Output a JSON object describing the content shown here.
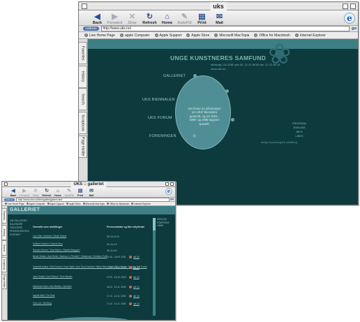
{
  "window_main": {
    "title": "uks",
    "toolbar": [
      {
        "label": "Back",
        "icon": "back-arrow-icon",
        "glyph": "◀",
        "enabled": true
      },
      {
        "label": "Forward",
        "icon": "forward-arrow-icon",
        "glyph": "▶",
        "enabled": false
      },
      {
        "label": "Stop",
        "icon": "stop-icon",
        "glyph": "✕",
        "enabled": false
      },
      {
        "label": "Refresh",
        "icon": "refresh-icon",
        "glyph": "↻",
        "enabled": true
      },
      {
        "label": "Home",
        "icon": "home-icon",
        "glyph": "⌂",
        "enabled": true
      },
      {
        "label": "AutoFill",
        "icon": "autofill-icon",
        "glyph": "✎",
        "enabled": false
      },
      {
        "label": "Print",
        "icon": "print-icon",
        "glyph": "▤",
        "enabled": true
      },
      {
        "label": "Mail",
        "icon": "mail-icon",
        "glyph": "✉",
        "enabled": true
      }
    ],
    "address_label": "Address",
    "address": "http://www.uks.no/",
    "go_label": "go",
    "favorites": [
      "Live Home Page",
      "apple Computer",
      "Apple Support",
      "Apple Store",
      "Microsoft MacTopia",
      "Office for Macintosh",
      "Internet Explorer"
    ],
    "sidebar_tabs": [
      "Favorites",
      "History",
      "Search",
      "Scrapbook",
      "Page Holder"
    ],
    "site": {
      "heading": "UNGE KUNSTNERES SAMFUND",
      "contact_line1": "rådhusgt. 15 0158 oslo 00, 22 42 96 66 fax: 22 42 66 16",
      "contact_line2": "www.uks.no",
      "menu": [
        "GALLERIET",
        "UKS BIENNALEN",
        "UKS FORUM",
        "FORENINGEN"
      ],
      "oval_text": "Her finner du informasjon om UKS' Biennalen generelt, og om 2001-, 1999- og 1998-utgaven spesielt.",
      "right_links": [
        "PROGRAM",
        "ENGLISH",
        "INFO",
        "LINKS"
      ],
      "credit": "design by primarypink publishing"
    }
  },
  "window_gallery": {
    "title": "UKS :: galleriet",
    "toolbar": [
      {
        "label": "Back",
        "icon": "back-arrow-icon",
        "glyph": "◀",
        "enabled": true
      },
      {
        "label": "Forward",
        "icon": "forward-arrow-icon",
        "glyph": "▶",
        "enabled": false
      },
      {
        "label": "Stop",
        "icon": "stop-icon",
        "glyph": "✕",
        "enabled": false
      },
      {
        "label": "Refresh",
        "icon": "refresh-icon",
        "glyph": "↻",
        "enabled": true
      },
      {
        "label": "Home",
        "icon": "home-icon",
        "glyph": "⌂",
        "enabled": true
      },
      {
        "label": "AutoFill",
        "icon": "autofill-icon",
        "glyph": "✎",
        "enabled": false
      },
      {
        "label": "Print",
        "icon": "print-icon",
        "glyph": "▤",
        "enabled": true
      },
      {
        "label": "Mail",
        "icon": "mail-icon",
        "glyph": "✉",
        "enabled": true
      }
    ],
    "address_label": "Address",
    "address": "http://www.uks.no/html/galleri/galleri.html",
    "go_label": "go",
    "favorites": [
      "Live Home Page",
      "Apple Computer",
      "Apple Support",
      "Apple Store",
      "Microsoft MacTopia",
      "Office for Macintosh",
      "Internet Explorer"
    ],
    "sidebar_tabs": [
      "Favorites",
      "History",
      "Search",
      "Scrapbook",
      "Page Holder"
    ],
    "site": {
      "heading": "GALLERIET",
      "left_menu": [
        "OM GALLERIET",
        "KALENDER",
        "TIDLIGERE",
        "PRESSE/KRITIKK",
        "KONTAKT"
      ],
      "col_heading_left": "Oversikt over utstillinger",
      "col_heading_right": "Presseomtale og Mer utfyllende",
      "rows": [
        {
          "title": "Line Ellen Hartvedt / Randi Strand",
          "date": "28. 03-01.04",
          "link": ""
        },
        {
          "title": "Kristine Hansen / Gunnar Moe",
          "date": "24. 04-1.5",
          "link": ""
        },
        {
          "title": "Rannei Grenne / Tone Myhre / Sophie Berggren",
          "date": "28. 5-24.6",
          "link": ""
        },
        {
          "title": "Bente Stokke / Ann Ekroll / Markus Li / Pernille T. Buskerud / Christian Tveit",
          "date": "21.08 - 16.09. 2001",
          "link": "sjå (3)"
        },
        {
          "title": "Svanhild Aasbø / Rolf Groven / Knut Fjelle / Ane Thon Knutsen / Mikal Telle / Marte Riis / Morten Traavik / Ola Fosse",
          "date": "17.09 - 16.10. 2000",
          "link": "sjå (1)"
        },
        {
          "title": "Jens Harald / Lise Strand / Tore Hansen",
          "date": "17.09 - 16.10. 2000",
          "link": "sjå (2)"
        },
        {
          "title": "Marianne Holm / Kari Brekke / Jan Moe",
          "date": "18.10 - 14.11. 2000",
          "link": "sjå (1)"
        },
        {
          "title": "Ingvild Dahl / Per Eide",
          "date": "17.10 - 14.11. 2000",
          "link": "sjå (4)"
        },
        {
          "title": "Tone Lie / Siri Berg",
          "date": "17.10 - 14.11. 2000",
          "link": "sjå (2)"
        }
      ],
      "right_links": [
        "ENGLISH",
        "STARTSIDE",
        "LINKS"
      ]
    }
  }
}
